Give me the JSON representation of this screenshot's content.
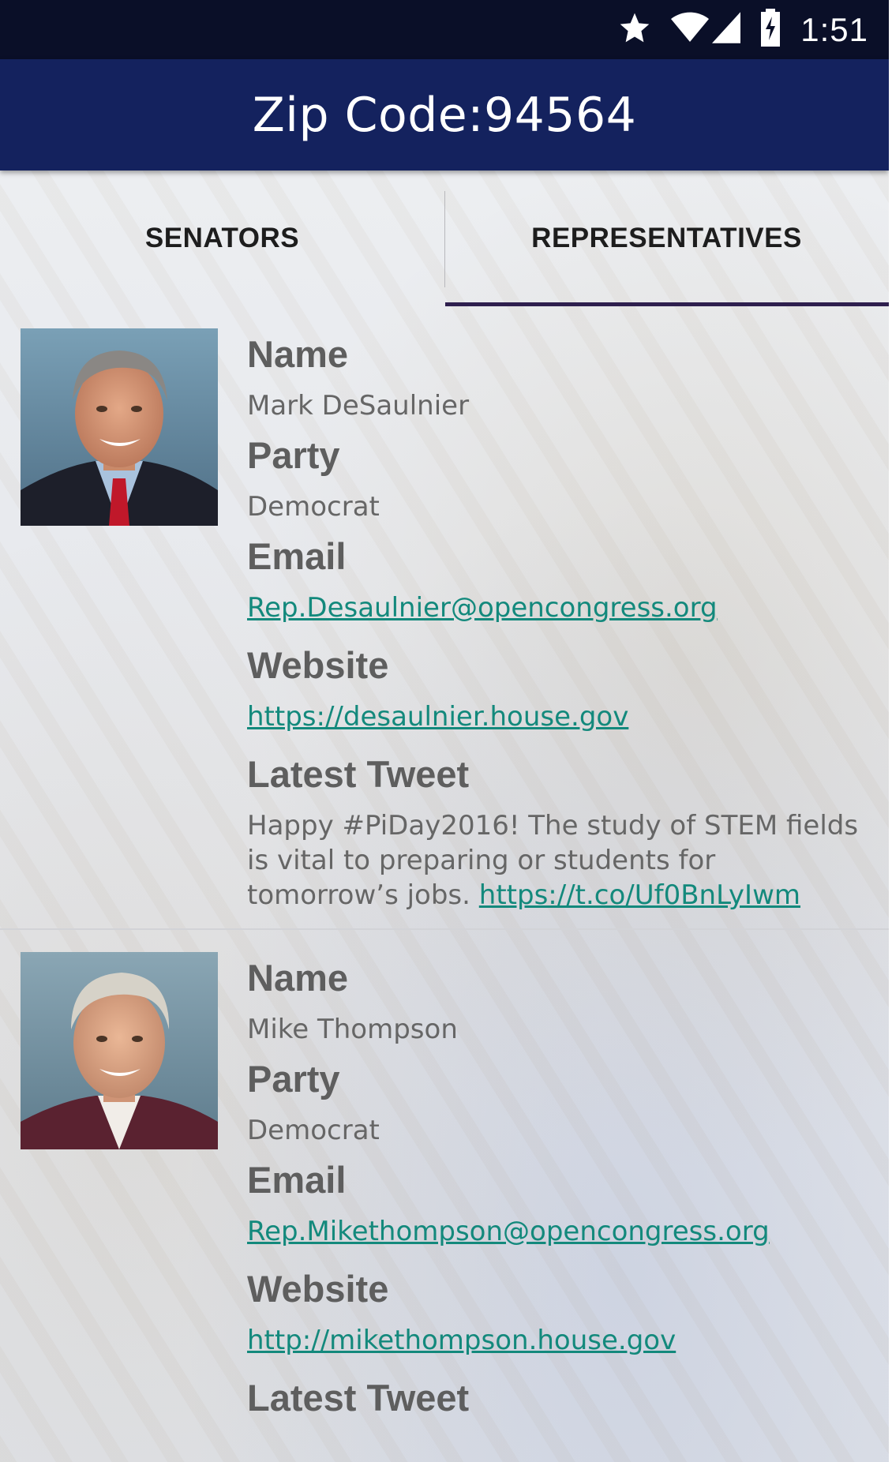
{
  "status_bar": {
    "time": "1:51",
    "icons": [
      "star-icon",
      "wifi-icon",
      "cell-signal-icon",
      "battery-charging-icon"
    ]
  },
  "app_bar": {
    "title": "Zip Code:94564"
  },
  "tabs": [
    {
      "label": "SENATORS",
      "selected": false
    },
    {
      "label": "REPRESENTATIVES",
      "selected": true
    }
  ],
  "colors": {
    "status_bar": "#0a0f28",
    "app_bar": "#14225e",
    "tab_indicator": "#2e1f4e",
    "link": "#13897c"
  },
  "labels": {
    "name": "Name",
    "party": "Party",
    "email": "Email",
    "website": "Website",
    "latest_tweet": "Latest Tweet"
  },
  "representatives": [
    {
      "name": "Mark DeSaulnier",
      "party": "Democrat",
      "email": "Rep.Desaulnier@opencongress.org",
      "website": "https://desaulnier.house.gov",
      "tweet_text": "Happy #PiDay2016! The study of STEM fields is vital to preparing or students for tomorrow’s jobs.",
      "tweet_link": "https://t.co/Uf0BnLyIwm"
    },
    {
      "name": "Mike Thompson",
      "party": "Democrat",
      "email": "Rep.Mikethompson@opencongress.org",
      "website": "http://mikethompson.house.gov"
    }
  ]
}
